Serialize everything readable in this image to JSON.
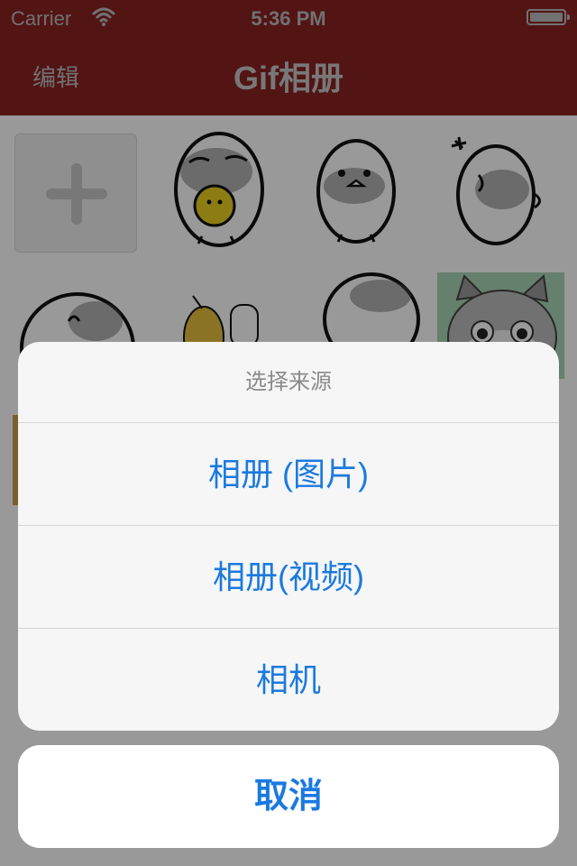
{
  "status_bar": {
    "carrier": "Carrier",
    "time": "5:36 PM"
  },
  "nav": {
    "edit_label": "编辑",
    "title": "Gif相册"
  },
  "action_sheet": {
    "title": "选择来源",
    "options": [
      "相册 (图片)",
      "相册(视频)",
      "相机"
    ],
    "cancel_label": "取消"
  },
  "colors": {
    "nav_background": "#8a2222",
    "action_tint": "#1a7ae0"
  }
}
